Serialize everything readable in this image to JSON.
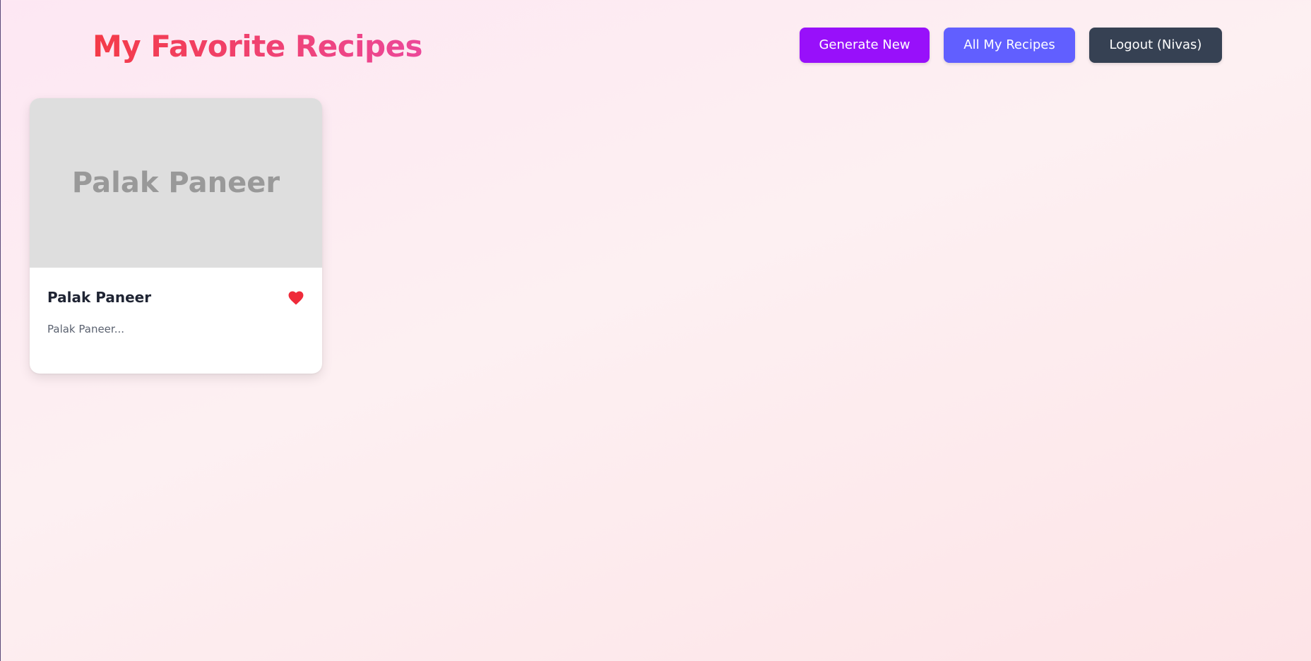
{
  "header": {
    "title": "My Favorite Recipes",
    "buttons": {
      "generate_label": "Generate New",
      "all_recipes_label": "All My Recipes",
      "logout_label": "Logout (Nivas)"
    }
  },
  "recipes": [
    {
      "image_placeholder_text": "Palak Paneer",
      "title": "Palak Paneer",
      "description": "Palak Paneer...",
      "favorite_icon": "heart-icon"
    }
  ],
  "colors": {
    "title_gradient_start": "#f43b47",
    "title_gradient_end": "#ec4899",
    "generate_button": "#9810fa",
    "all_recipes_button": "#615fff",
    "logout_button": "#364153",
    "favorite_heart": "#ef2b3a"
  }
}
